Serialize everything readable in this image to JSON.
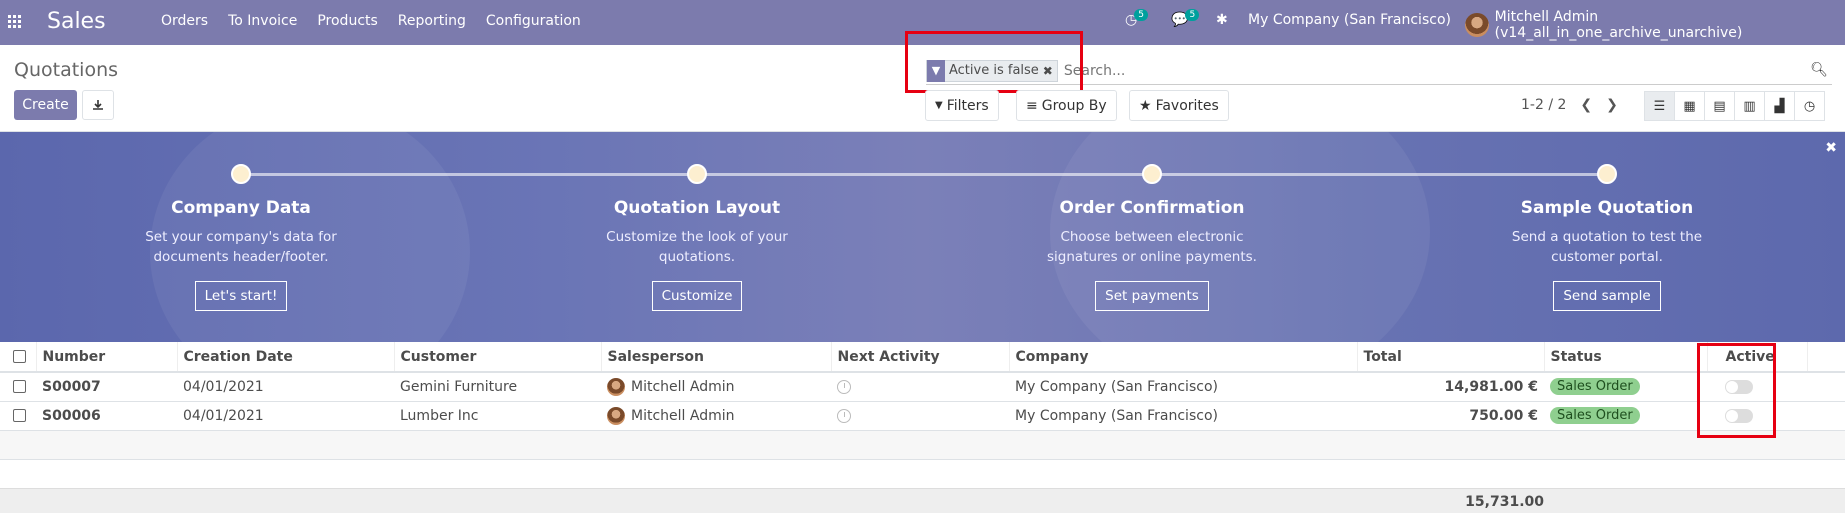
{
  "app": {
    "name": "Sales"
  },
  "menu": [
    "Orders",
    "To Invoice",
    "Products",
    "Reporting",
    "Configuration"
  ],
  "systray": {
    "activity_count": "5",
    "messages_count": "5",
    "company": "My Company (San Francisco)",
    "user": "Mitchell Admin (v14_all_in_one_archive_unarchive)"
  },
  "control_panel": {
    "breadcrumb": "Quotations",
    "create_label": "Create",
    "facet_text": "Active is false",
    "search_placeholder": "Search...",
    "filters_label": "Filters",
    "groupby_label": "Group By",
    "favorites_label": "Favorites",
    "pager": "1-2 / 2"
  },
  "onboarding": {
    "steps": [
      {
        "title": "Company Data",
        "desc_line1": "Set your company's data for",
        "desc_line2": "documents header/footer.",
        "button": "Let's start!"
      },
      {
        "title": "Quotation Layout",
        "desc_line1": "Customize the look of your",
        "desc_line2": "quotations.",
        "button": "Customize"
      },
      {
        "title": "Order Confirmation",
        "desc_line1": "Choose between electronic",
        "desc_line2": "signatures or online payments.",
        "button": "Set payments"
      },
      {
        "title": "Sample Quotation",
        "desc_line1": "Send a quotation to test the",
        "desc_line2": "customer portal.",
        "button": "Send sample"
      }
    ]
  },
  "table": {
    "headers": {
      "number": "Number",
      "creation_date": "Creation Date",
      "customer": "Customer",
      "salesperson": "Salesperson",
      "next_activity": "Next Activity",
      "company": "Company",
      "total": "Total",
      "status": "Status",
      "active": "Active"
    },
    "rows": [
      {
        "number": "S00007",
        "date": "04/01/2021",
        "customer": "Gemini Furniture",
        "salesperson": "Mitchell Admin",
        "company": "My Company (San Francisco)",
        "total": "14,981.00 €",
        "status": "Sales Order",
        "active": false
      },
      {
        "number": "S00006",
        "date": "04/01/2021",
        "customer": "Lumber Inc",
        "salesperson": "Mitchell Admin",
        "company": "My Company (San Francisco)",
        "total": "750.00 €",
        "status": "Sales Order",
        "active": false
      }
    ],
    "sum_total": "15,731.00"
  },
  "colors": {
    "brand": "#7c7bad",
    "highlight": "#e60012",
    "status_bg": "#8fcf8f"
  }
}
